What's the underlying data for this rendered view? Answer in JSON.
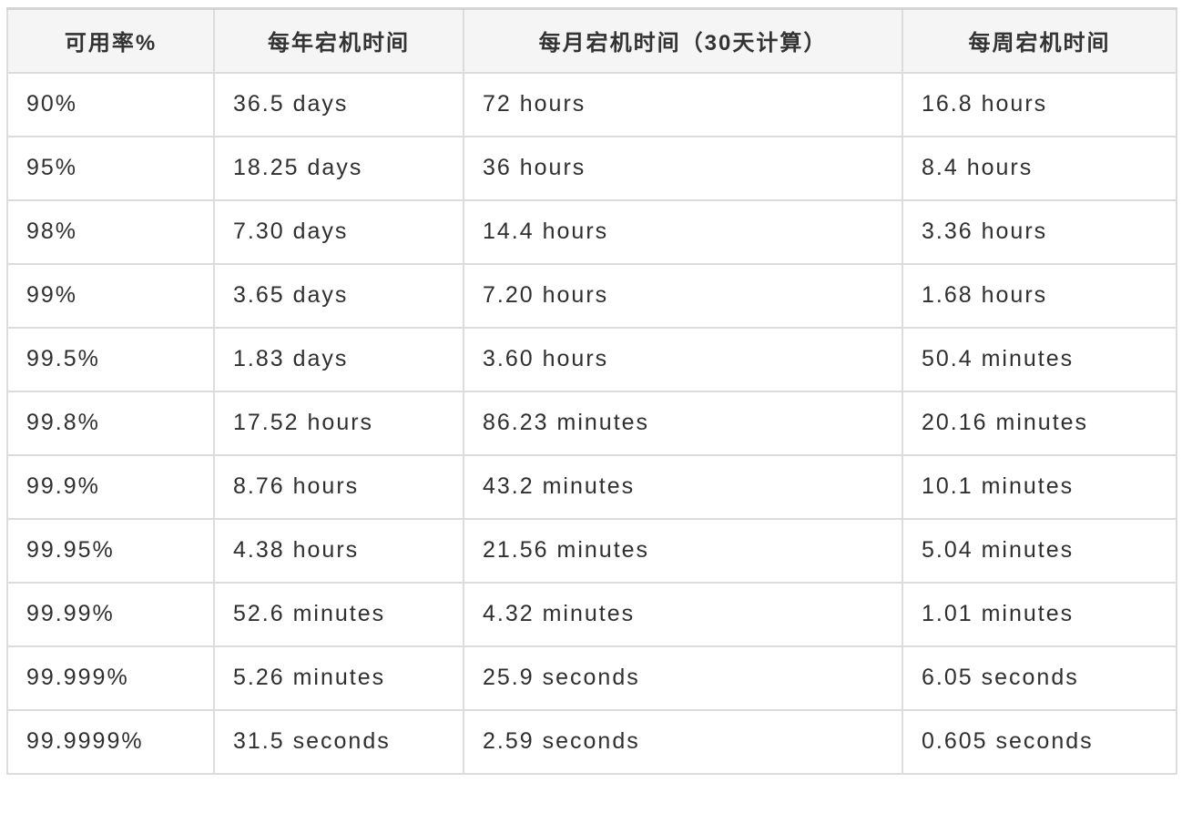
{
  "table": {
    "headers": [
      "可用率%",
      "每年宕机时间",
      "每月宕机时间（30天计算）",
      "每周宕机时间"
    ],
    "rows": [
      [
        "90%",
        "36.5 days",
        "72 hours",
        "16.8 hours"
      ],
      [
        "95%",
        "18.25 days",
        "36 hours",
        "8.4 hours"
      ],
      [
        "98%",
        "7.30 days",
        "14.4 hours",
        "3.36 hours"
      ],
      [
        "99%",
        "3.65 days",
        "7.20 hours",
        "1.68 hours"
      ],
      [
        "99.5%",
        "1.83 days",
        "3.60 hours",
        "50.4 minutes"
      ],
      [
        "99.8%",
        "17.52 hours",
        "86.23 minutes",
        "20.16 minutes"
      ],
      [
        "99.9%",
        "8.76 hours",
        "43.2 minutes",
        "10.1 minutes"
      ],
      [
        "99.95%",
        "4.38 hours",
        "21.56 minutes",
        "5.04 minutes"
      ],
      [
        "99.99%",
        "52.6 minutes",
        "4.32 minutes",
        "1.01 minutes"
      ],
      [
        "99.999%",
        "5.26 minutes",
        "25.9 seconds",
        "6.05 seconds"
      ],
      [
        "99.9999%",
        "31.5 seconds",
        "2.59 seconds",
        "0.605 seconds"
      ]
    ]
  },
  "colors": {
    "header_background": "#f5f5f5",
    "border": "#dcdcdc",
    "text": "#2f2f2f"
  }
}
